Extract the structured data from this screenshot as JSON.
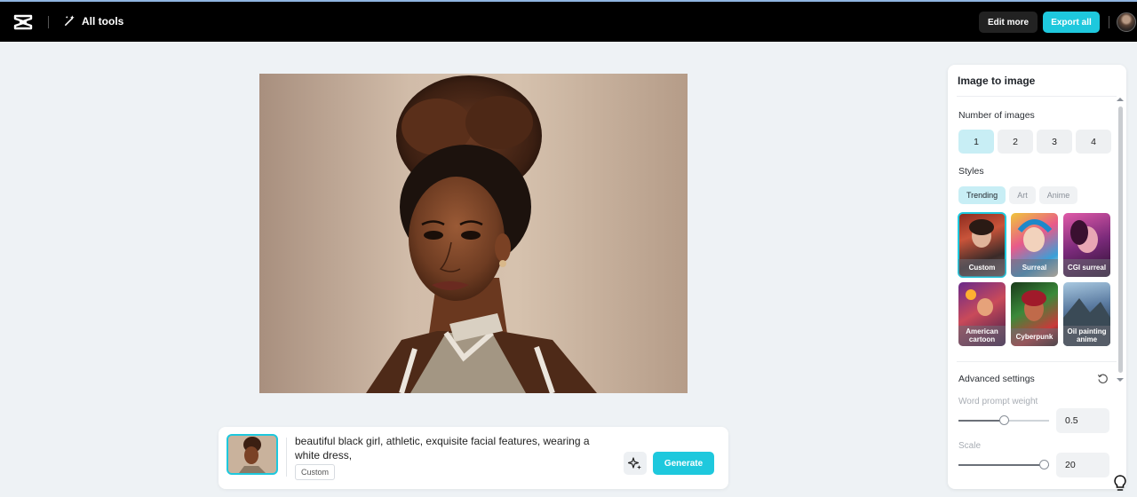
{
  "topbar": {
    "all_tools_label": "All tools",
    "edit_more_label": "Edit more",
    "export_all_label": "Export all"
  },
  "prompt": {
    "text": "beautiful black girl, athletic, exquisite facial features, wearing a white dress,",
    "tag": "Custom",
    "generate_label": "Generate"
  },
  "panel": {
    "title": "Image to image",
    "number_of_images_label": "Number of images",
    "number_options": [
      "1",
      "2",
      "3",
      "4"
    ],
    "selected_number": "1",
    "styles_label": "Styles",
    "style_tabs": [
      "Trending",
      "Art",
      "Anime"
    ],
    "active_tab": "Trending",
    "styles": [
      {
        "label": "Custom",
        "selected": true
      },
      {
        "label": "Surreal",
        "selected": false
      },
      {
        "label": "CGI surreal",
        "selected": false
      },
      {
        "label": "American cartoon",
        "selected": false
      },
      {
        "label": "Cyberpunk",
        "selected": false
      },
      {
        "label": "Oil painting anime",
        "selected": false
      }
    ],
    "advanced_settings_label": "Advanced settings",
    "word_prompt_weight_label": "Word prompt weight",
    "word_prompt_weight_value": "0.5",
    "word_prompt_weight_fraction": 0.5,
    "scale_label": "Scale",
    "scale_value": "20",
    "scale_fraction": 1.0
  },
  "colors": {
    "accent": "#1ec8dd",
    "topbar_bg": "#000000",
    "page_bg": "#eef2f5"
  },
  "icons": [
    "capcut-logo-icon",
    "magic-wand-icon",
    "user-avatar",
    "sparkle-icon",
    "reset-icon",
    "lightbulb-icon"
  ]
}
